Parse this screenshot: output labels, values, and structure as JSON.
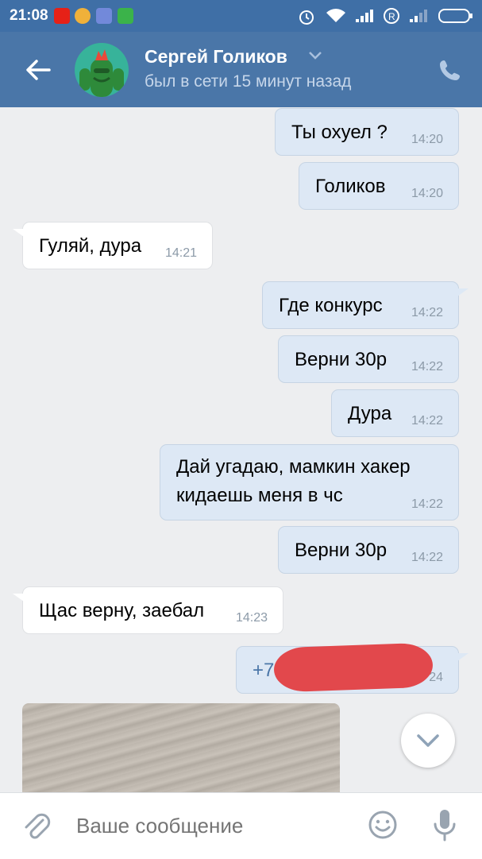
{
  "status_bar": {
    "time": "21:08"
  },
  "header": {
    "contact_name": "Сергей Голиков",
    "contact_status": "был в сети 15 минут назад",
    "icons": [
      "back-arrow-icon",
      "chevron-down-icon",
      "phone-icon"
    ]
  },
  "messages": [
    {
      "dir": "out",
      "text": "Ты охуел ?",
      "time": "14:20"
    },
    {
      "dir": "out",
      "text": "Голиков",
      "time": "14:20"
    },
    {
      "dir": "in",
      "text": "Гуляй, дура",
      "time": "14:21"
    },
    {
      "dir": "out",
      "text": "Где конкурс",
      "time": "14:22"
    },
    {
      "dir": "out",
      "text": "Верни 30р",
      "time": "14:22"
    },
    {
      "dir": "out",
      "text": "Дура",
      "time": "14:22"
    },
    {
      "dir": "out",
      "text_line1": "Дай угадаю, мамкин хакер",
      "text_line2": "кидаешь меня в чс",
      "time": "14:22"
    },
    {
      "dir": "out",
      "text": "Верни 30р",
      "time": "14:22"
    },
    {
      "dir": "in",
      "text": "Щас верну, заебал",
      "time": "14:23"
    },
    {
      "dir": "out",
      "text": "+7",
      "time": "24",
      "redacted": true
    }
  ],
  "input": {
    "placeholder": "Ваше сообщение",
    "icons": [
      "paperclip-icon",
      "emoji-icon",
      "microphone-icon"
    ]
  },
  "colors": {
    "header": "#4a76a8",
    "status_bar": "#3f6fa6",
    "outgoing_bubble": "#dde8f5",
    "incoming_bubble": "#ffffff",
    "background": "#edeef0",
    "redaction": "#e2484c"
  }
}
